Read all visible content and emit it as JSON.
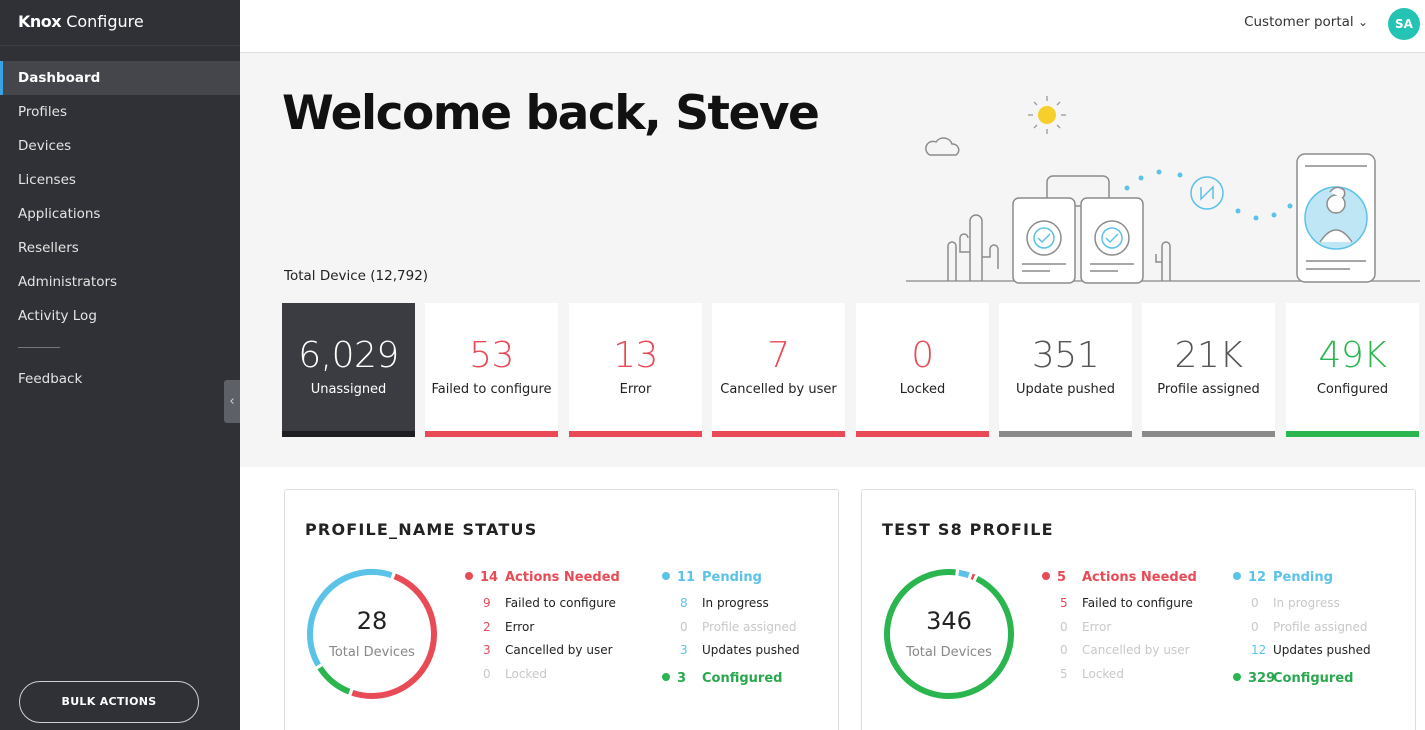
{
  "app": {
    "brand_bold": "Knox",
    "brand_rest": " Configure"
  },
  "sidebar": {
    "items": [
      {
        "label": "Dashboard",
        "active": true
      },
      {
        "label": "Profiles"
      },
      {
        "label": "Devices"
      },
      {
        "label": "Licenses"
      },
      {
        "label": "Applications"
      },
      {
        "label": "Resellers"
      },
      {
        "label": "Administrators"
      },
      {
        "label": "Activity Log"
      }
    ],
    "feedback": "Feedback",
    "collapse_icon": "‹",
    "bulk_actions": "BULK ACTIONS"
  },
  "topbar": {
    "portal": "Customer portal",
    "chevron": "⌄",
    "avatar": "SA"
  },
  "hero": {
    "welcome": "Welcome back, Steve",
    "total_device": "Total Device (12,792)"
  },
  "colors": {
    "red": "#e84a56",
    "gray": "#8a8a8a",
    "green": "#2ab54f",
    "blue": "#5bc2e8",
    "dark": "#3a3c41"
  },
  "status_cards": [
    {
      "value": "6,029",
      "label": "Unassigned",
      "color": "#ffffff",
      "bar": "#1e1f22",
      "dark": true
    },
    {
      "value": "53",
      "label": "Failed to configure",
      "color": "#e84a56",
      "bar": "#e84a56"
    },
    {
      "value": "13",
      "label": "Error",
      "color": "#e84a56",
      "bar": "#e84a56"
    },
    {
      "value": "7",
      "label": "Cancelled by user",
      "color": "#e84a56",
      "bar": "#e84a56"
    },
    {
      "value": "0",
      "label": "Locked",
      "color": "#e84a56",
      "bar": "#e84a56"
    },
    {
      "value": "351",
      "label": "Update pushed",
      "color": "#555555",
      "bar": "#8a8a8a"
    },
    {
      "value": "21K",
      "label": "Profile assigned",
      "color": "#555555",
      "bar": "#8a8a8a"
    },
    {
      "value": "49K",
      "label": "Configured",
      "color": "#2ab54f",
      "bar": "#2ab54f"
    }
  ],
  "panels": [
    {
      "title": "PROFILE_NAME STATUS",
      "total": "28",
      "total_label": "Total Devices",
      "segments": [
        {
          "color": "#e84a56",
          "fraction": 0.5
        },
        {
          "color": "#2ab54f",
          "fraction": 0.107
        },
        {
          "color": "#5bc2e8",
          "fraction": 0.393
        }
      ],
      "actions": {
        "count": "14",
        "label": "Actions Needed",
        "rows": [
          {
            "count": "9",
            "label": "Failed to configure",
            "active": true
          },
          {
            "count": "2",
            "label": "Error",
            "active": true
          },
          {
            "count": "3",
            "label": "Cancelled by user",
            "active": true
          },
          {
            "count": "0",
            "label": "Locked",
            "active": false
          }
        ]
      },
      "pending": {
        "count": "11",
        "label": "Pending",
        "rows": [
          {
            "count": "8",
            "label": "In progress",
            "active": true
          },
          {
            "count": "0",
            "label": "Profile assigned",
            "active": false
          },
          {
            "count": "3",
            "label": "Updates pushed",
            "active": true
          }
        ]
      },
      "configured": {
        "count": "3",
        "label": "Configured"
      }
    },
    {
      "title": "TEST S8 PROFILE",
      "total": "346",
      "total_label": "Total Devices",
      "segments": [
        {
          "color": "#e84a56",
          "fraction": 0.0145
        },
        {
          "color": "#2ab54f",
          "fraction": 0.951
        },
        {
          "color": "#5bc2e8",
          "fraction": 0.0347
        }
      ],
      "actions": {
        "count": "5",
        "label": "Actions Needed",
        "rows": [
          {
            "count": "5",
            "label": "Failed to configure",
            "active": true
          },
          {
            "count": "0",
            "label": "Error",
            "active": false
          },
          {
            "count": "0",
            "label": "Cancelled by user",
            "active": false
          },
          {
            "count": "5",
            "label": "Locked",
            "active": false
          }
        ]
      },
      "pending": {
        "count": "12",
        "label": "Pending",
        "rows": [
          {
            "count": "0",
            "label": "In progress",
            "active": false
          },
          {
            "count": "0",
            "label": "Profile assigned",
            "active": false
          },
          {
            "count": "12",
            "label": "Updates pushed",
            "active": true
          }
        ]
      },
      "configured": {
        "count": "329",
        "label": "Configured"
      }
    }
  ]
}
